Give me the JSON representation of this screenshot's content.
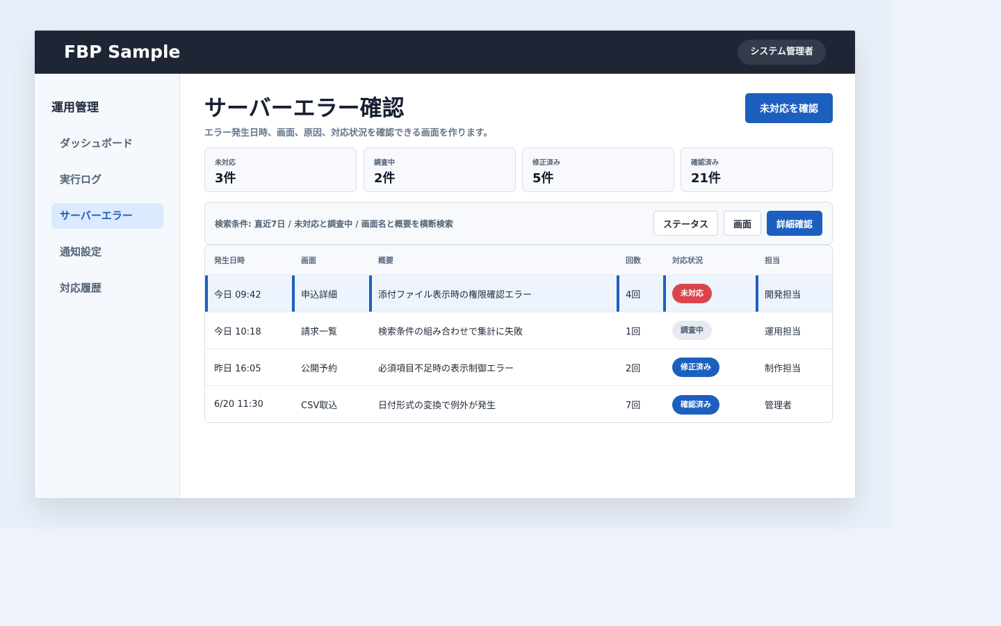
{
  "app": {
    "brand": "FBP Sample",
    "user_role": "システム管理者"
  },
  "sidebar": {
    "section_title": "運用管理",
    "items": [
      {
        "label": "ダッシュボード",
        "active": false
      },
      {
        "label": "実行ログ",
        "active": false
      },
      {
        "label": "サーバーエラー",
        "active": true
      },
      {
        "label": "通知設定",
        "active": false
      },
      {
        "label": "対応履歴",
        "active": false
      }
    ]
  },
  "main": {
    "title": "サーバーエラー確認",
    "description": "エラー発生日時、画面、原因、対応状況を確認できる画面を作ります。",
    "primary_action": "未対応を確認"
  },
  "stats": [
    {
      "label": "未対応",
      "value": "3件"
    },
    {
      "label": "調査中",
      "value": "2件"
    },
    {
      "label": "修正済み",
      "value": "5件"
    },
    {
      "label": "確認済み",
      "value": "21件"
    }
  ],
  "filter": {
    "summary": "検索条件: 直近7日 / 未対応と調査中 / 画面名と概要を横断検索",
    "buttons": {
      "status": "ステータス",
      "screen": "画面",
      "detail": "詳細確認"
    }
  },
  "table": {
    "columns": [
      "発生日時",
      "画面",
      "概要",
      "回数",
      "対応状況",
      "担当"
    ],
    "rows": [
      {
        "datetime": "今日 09:42",
        "screen": "申込詳細",
        "summary": "添付ファイル表示時の権限確認エラー",
        "count": "4回",
        "status": "未対応",
        "status_color": "#d9454a",
        "owner": "開発担当",
        "selected": true
      },
      {
        "datetime": "今日 10:18",
        "screen": "請求一覧",
        "summary": "検索条件の組み合わせで集計に失敗",
        "count": "1回",
        "status": "調査中",
        "status_color": "#e6ebf1",
        "owner": "運用担当",
        "selected": false
      },
      {
        "datetime": "昨日 16:05",
        "screen": "公開予約",
        "summary": "必須項目不足時の表示制御エラー",
        "count": "2回",
        "status": "修正済み",
        "status_color": "#1d5fbf",
        "owner": "制作担当",
        "selected": false
      },
      {
        "datetime": "6/20 11:30",
        "screen": "CSV取込",
        "summary": "日付形式の変換で例外が発生",
        "count": "7回",
        "status": "確認済み",
        "status_color": "#1d5fbf",
        "owner": "管理者",
        "selected": false
      }
    ]
  }
}
